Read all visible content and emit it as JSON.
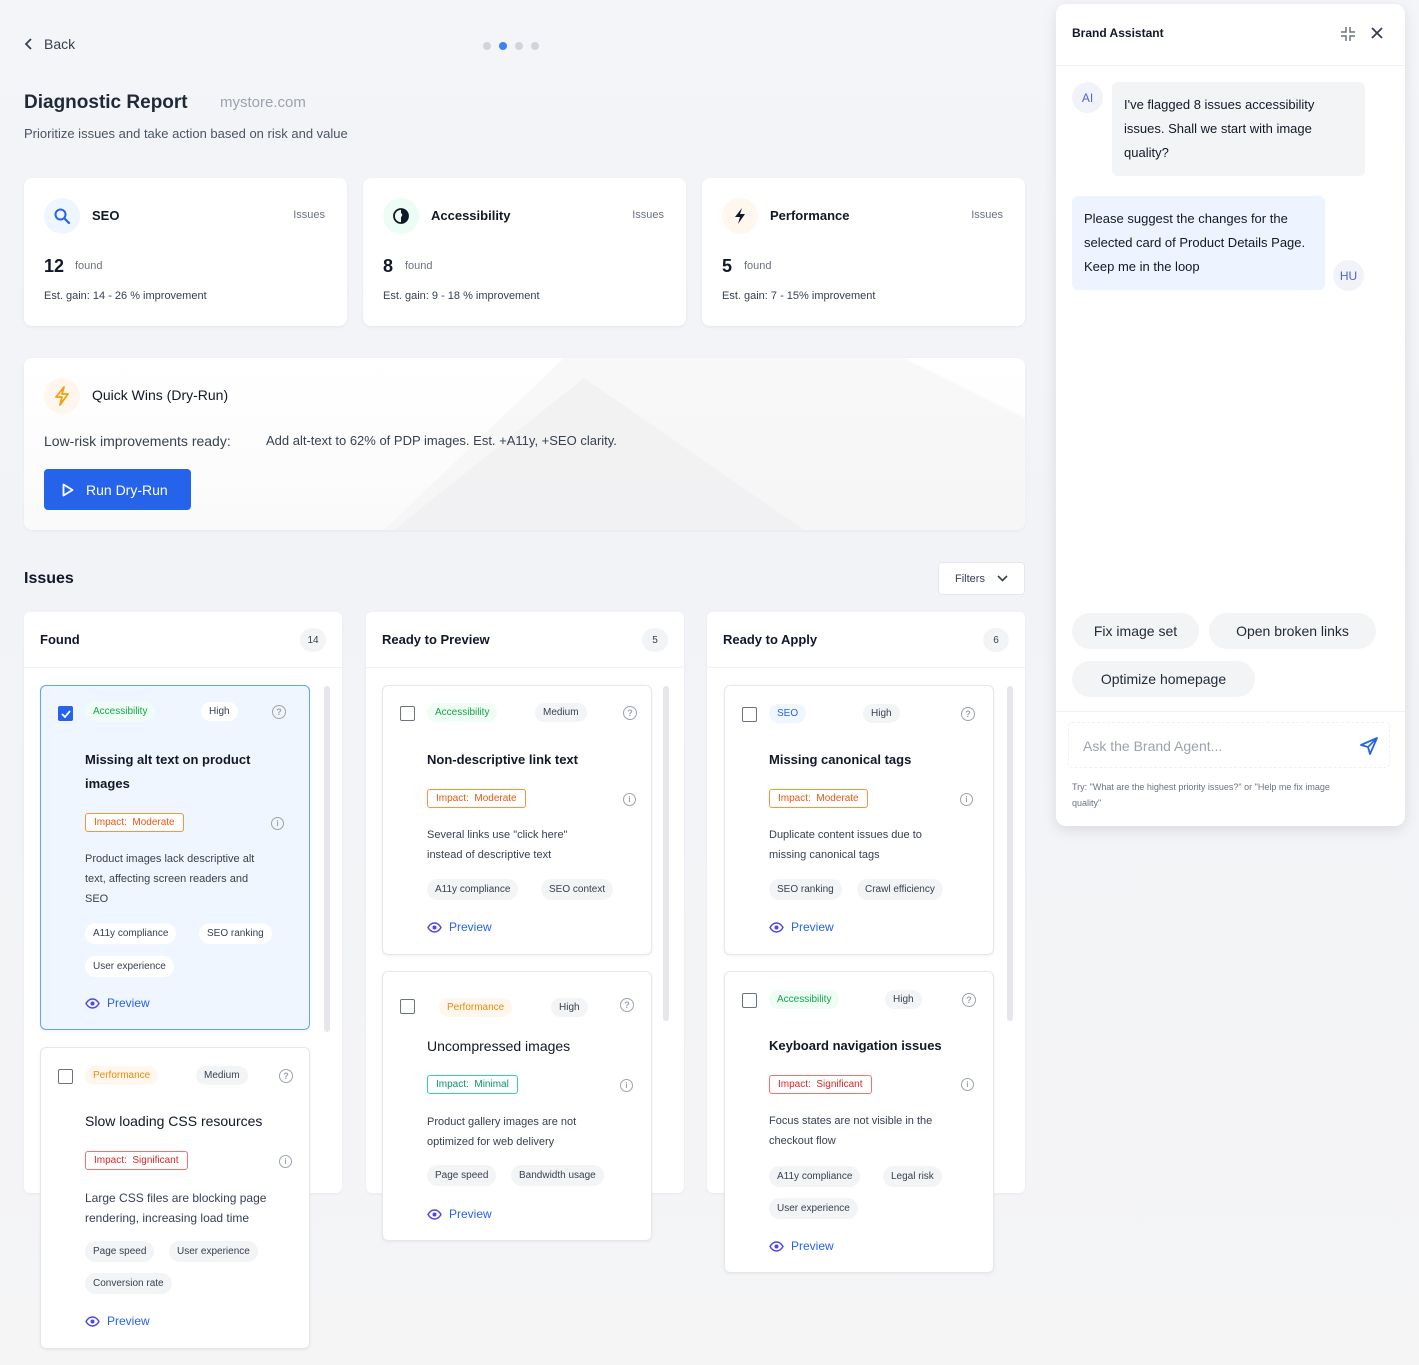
{
  "nav": {
    "back_label": "Back",
    "steps": 4,
    "active_step": 2
  },
  "header": {
    "title": "Diagnostic Report",
    "domain": "mystore.com",
    "subtitle": "Prioritize issues and take action based on risk and value"
  },
  "summary": [
    {
      "name": "SEO",
      "issues_label": "Issues",
      "count": "12",
      "found_label": "found",
      "gain": "Est. gain: 14 - 26 % improvement",
      "icon": "search-icon",
      "accent": "#2563eb"
    },
    {
      "name": "Accessibility",
      "issues_label": "Issues",
      "count": "8",
      "found_label": "found",
      "gain": "Est. gain: 9 - 18 % improvement",
      "icon": "accessibility-icon",
      "accent": "#059669"
    },
    {
      "name": "Performance",
      "issues_label": "Issues",
      "count": "5",
      "found_label": "found",
      "gain": "Est. gain: 7 - 15% improvement",
      "icon": "lightning-icon",
      "accent": "#111827"
    }
  ],
  "quick_wins": {
    "title": "Quick Wins (Dry-Run)",
    "label": "Low-risk improvements ready:",
    "text": "Add alt-text to 62% of PDP images. Est. +A11y, +SEO clarity.",
    "button": "Run Dry-Run",
    "icon": "lightning-icon"
  },
  "issues": {
    "title": "Issues",
    "filters_label": "Filters",
    "columns": [
      {
        "name": "Found",
        "count": "14",
        "cards": [
          {
            "category": "Accessibility",
            "priority": "High",
            "title": "Missing alt text on product images",
            "impact_label": "Impact:",
            "impact": "Moderate",
            "description": "Product images lack descriptive alt text, affecting screen readers and SEO",
            "tags": [
              "A11y compliance",
              "SEO ranking",
              "User experience"
            ],
            "preview_label": "Preview",
            "selected": true
          },
          {
            "category": "Performance",
            "priority": "Medium",
            "title": "Slow loading CSS resources",
            "impact_label": "Impact:",
            "impact": "Significant",
            "description": "Large CSS files are blocking page rendering, increasing load time",
            "tags": [
              "Page speed",
              "User experience",
              "Conversion rate"
            ],
            "preview_label": "Preview",
            "selected": false
          }
        ]
      },
      {
        "name": "Ready to Preview",
        "count": "5",
        "cards": [
          {
            "category": "Accessibility",
            "priority": "Medium",
            "title": "Non-descriptive link text",
            "impact_label": "Impact:",
            "impact": "Moderate",
            "description": "Several links use \"click here\" instead of descriptive text",
            "tags": [
              "A11y compliance",
              "SEO context"
            ],
            "preview_label": "Preview",
            "selected": false
          },
          {
            "category": "Performance",
            "priority": "High",
            "title": "Uncompressed images",
            "impact_label": "Impact:",
            "impact": "Minimal",
            "description": "Product gallery images are not optimized for web delivery",
            "tags": [
              "Page speed",
              "Bandwidth usage"
            ],
            "preview_label": "Preview",
            "selected": false
          }
        ]
      },
      {
        "name": "Ready to Apply",
        "count": "6",
        "cards": [
          {
            "category": "SEO",
            "priority": "High",
            "title": "Missing canonical tags",
            "impact_label": "Impact:",
            "impact": "Moderate",
            "description": "Duplicate content issues due to missing canonical tags",
            "tags": [
              "SEO ranking",
              "Crawl efficiency"
            ],
            "preview_label": "Preview",
            "selected": false
          },
          {
            "category": "Accessibility",
            "priority": "High",
            "title": "Keyboard navigation issues",
            "impact_label": "Impact:",
            "impact": "Significant",
            "description": "Focus states are not visible in the checkout flow",
            "tags": [
              "A11y compliance",
              "Legal risk",
              "User experience"
            ],
            "preview_label": "Preview",
            "selected": false
          }
        ]
      }
    ]
  },
  "assistant": {
    "title": "Brand Assistant",
    "messages": [
      {
        "from": "AI",
        "text": "I've flagged 8 issues accessibility issues. Shall we start with image quality?"
      },
      {
        "from": "HU",
        "text": "Please suggest the changes for the selected card of Product Details Page. Keep me in the loop"
      }
    ],
    "suggestions": [
      "Fix image set",
      "Open broken links",
      "Optimize homepage"
    ],
    "input_placeholder": "Ask the Brand Agent...",
    "hint": "Try: \"What are the highest priority issues?\" or \"Help me fix image quality\""
  },
  "colors": {
    "primary": "#2563eb",
    "accessibility": "#16a34a",
    "performance": "#ea8a0c",
    "impact_moderate": "#ea580c",
    "impact_significant": "#dc2626",
    "impact_minimal": "#059669"
  }
}
